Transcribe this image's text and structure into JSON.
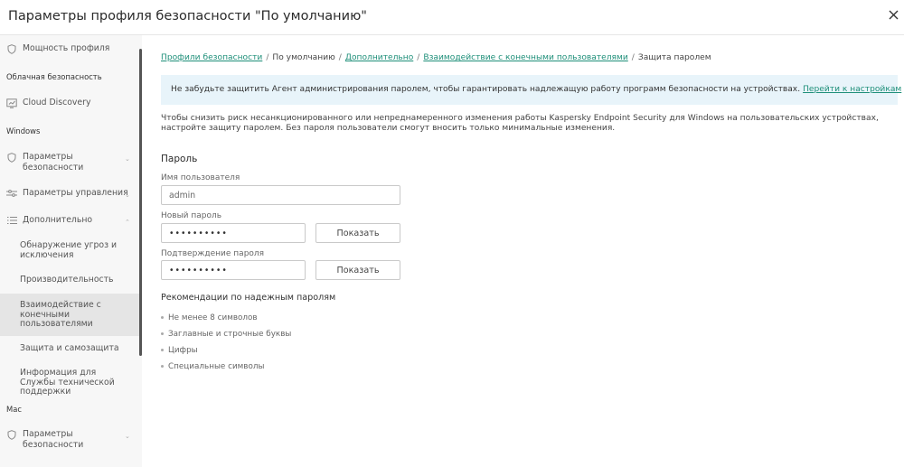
{
  "header": {
    "title": "Параметры профиля безопасности \"По умолчанию\""
  },
  "sidebar": {
    "profile_power": "Мощность профиля",
    "section_cloud": "Облачная безопасность",
    "cloud_discovery": "Cloud Discovery",
    "section_windows": "Windows",
    "security_params": "Параметры безопасности",
    "management_params": "Параметры управления",
    "additional": "Дополнительно",
    "sub_threat_detection": "Обнаружение угроз и исключения",
    "sub_performance": "Производительность",
    "sub_user_interaction": "Взаимодействие с конечными пользователями",
    "sub_self_defense": "Защита и самозащита",
    "sub_support_info": "Информация для Службы технической поддержки",
    "section_mac": "Mac",
    "mac_security_params": "Параметры безопасности"
  },
  "breadcrumb": {
    "item1": "Профили безопасности",
    "item2": "По умолчанию",
    "item3": "Дополнительно",
    "item4": "Взаимодействие с конечными пользователями",
    "item5": "Защита паролем",
    "separator": "/"
  },
  "notice": {
    "text": "Не забудьте защитить Агент администрирования паролем, чтобы гарантировать надлежащую работу программ безопасности на устройствах.",
    "link": "Перейти к настройкам"
  },
  "description": "Чтобы снизить риск несанкционированного или непреднамеренного изменения работы Kaspersky Endpoint Security для Windows на пользовательских устройствах, настройте защиту паролем. Без пароля пользователи смогут вносить только минимальные изменения.",
  "password_section": {
    "title": "Пароль",
    "username_label": "Имя пользователя",
    "username_value": "admin",
    "new_password_label": "Новый пароль",
    "new_password_value": "••••••••••",
    "confirm_label": "Подтверждение пароля",
    "confirm_value": "••••••••••",
    "show_button": "Показать"
  },
  "recommendations": {
    "title": "Рекомендации по надежным паролям",
    "items": [
      "Не менее 8 символов",
      "Заглавные и строчные буквы",
      "Цифры",
      "Специальные символы"
    ]
  },
  "icons": {
    "close": "close-icon",
    "profile_power": "shield-outline-icon",
    "cloud_discovery": "cloud-discovery-icon",
    "security_params": "shield-outline-icon",
    "management_params": "sliders-icon",
    "additional": "list-icon"
  },
  "colors": {
    "link": "#1e8f79",
    "notice_bg": "#e8f4fa",
    "sidebar_bg": "#f7f7f7",
    "active_item_bg": "#e5e5e5"
  }
}
